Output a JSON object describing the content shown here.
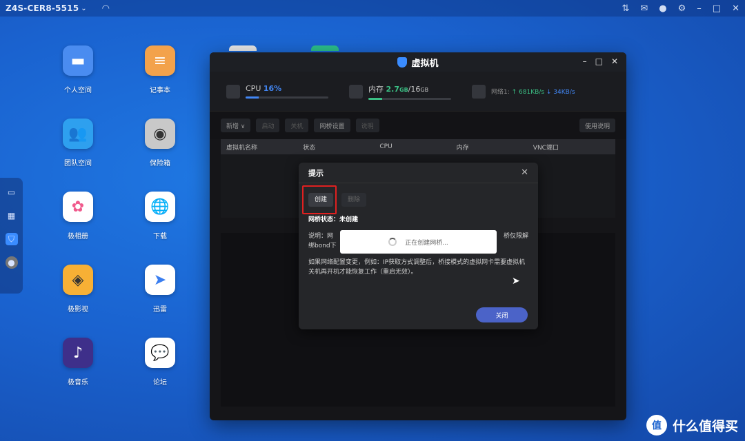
{
  "topbar": {
    "device": "Z4S-CER8-5515",
    "icons": [
      "chevron-down-icon",
      "wifi-icon",
      "transfer-icon",
      "mail-icon",
      "user-icon",
      "gear-icon",
      "minimize-icon",
      "maximize-icon",
      "close-icon"
    ]
  },
  "desktop": {
    "apps": [
      {
        "label": "个人空间",
        "icon": "folder-icon",
        "color": "#4a8cf0"
      },
      {
        "label": "记事本",
        "icon": "notepad-icon",
        "color": "#f3a24b"
      },
      {
        "label": "团队空间",
        "icon": "team-folder-icon",
        "color": "#2ea0ef"
      },
      {
        "label": "保险箱",
        "icon": "safe-icon",
        "color": "#c9c9c9"
      },
      {
        "label": "极相册",
        "icon": "photos-icon",
        "color": "#ffffff"
      },
      {
        "label": "下载",
        "icon": "download-icon",
        "color": "#ffffff"
      },
      {
        "label": "极影视",
        "icon": "video-icon",
        "color": "#f7b035"
      },
      {
        "label": "迅雷",
        "icon": "thunder-icon",
        "color": "#ffffff"
      },
      {
        "label": "极音乐",
        "icon": "music-icon",
        "color": "#3e2f8a"
      },
      {
        "label": "论坛",
        "icon": "forum-icon",
        "color": "#ffffff"
      }
    ]
  },
  "vm": {
    "title": "虚拟机",
    "cpu": {
      "label": "CPU",
      "value": "16%",
      "percent": 16
    },
    "mem": {
      "label": "内存",
      "used": "2.7",
      "used_unit": "GB",
      "sep": "/",
      "total": "16",
      "total_unit": "GB",
      "percent": 17
    },
    "net": {
      "label": "网络1:",
      "up": "↑ 681KB/s",
      "down": "↓ 34KB/s"
    },
    "toolbar": {
      "new": "新增 ∨",
      "start": "启动",
      "stop": "关机",
      "net_settings": "网桥设置",
      "note": "说明",
      "help": "使用说明"
    },
    "table_headers": [
      "虚拟机名称",
      "状态",
      "CPU",
      "内存",
      "VNC端口"
    ]
  },
  "dialog": {
    "title": "提示",
    "create": "创建",
    "delete": "删除",
    "bridge_status": "网桥状态：未创建",
    "note_line1_a": "说明：网",
    "note_line1_b": "桥仅限解",
    "note_line2": "绑bond下",
    "note2": "如果网络配置变更，例如：IP获取方式调整后，桥接模式的虚拟网卡需要虚拟机关机再开机才能恢复工作（重启无效）。",
    "close": "关闭"
  },
  "toast": {
    "text": "正在创建网桥..."
  },
  "watermark": {
    "text": "什么值得买",
    "logo": "值"
  }
}
